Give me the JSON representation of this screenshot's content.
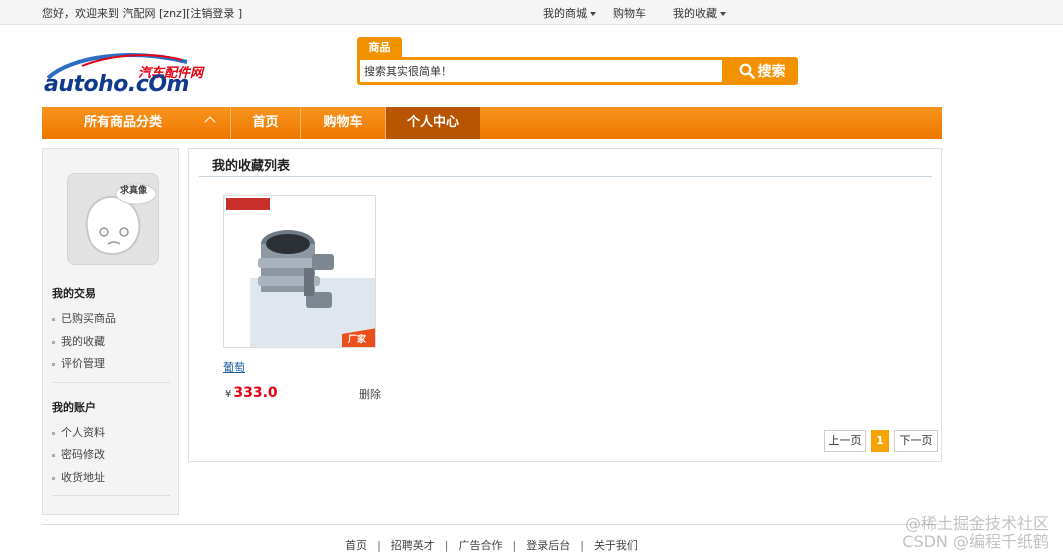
{
  "topbar": {
    "welcome_prefix": "您好，欢迎来到 汽配网",
    "username": "[znz][",
    "logout": "注销登录",
    "welcome_suffix": "]",
    "links": [
      {
        "label": "我的商城",
        "dropdown": true
      },
      {
        "label": "购物车",
        "dropdown": false
      },
      {
        "label": "我的收藏",
        "dropdown": true
      }
    ]
  },
  "logo": {
    "cn": "汽车配件网",
    "en": "autoho.cOm",
    "color_brand": "#123a8c",
    "color_accent": "#e60012"
  },
  "search": {
    "tab_label": "商品",
    "value": "搜索其实很简单！",
    "button_label": "搜索",
    "button_icon": "search-icon",
    "color": "#f39200"
  },
  "mainnav": {
    "category_label": "所有商品分类",
    "items": [
      {
        "label": "首页",
        "active": false
      },
      {
        "label": "购物车",
        "active": false
      },
      {
        "label": "个人中心",
        "active": true
      }
    ]
  },
  "sidebar": {
    "avatar_label": "求真像",
    "sections": [
      {
        "title": "我的交易",
        "links": [
          "已购买商品",
          "我的收藏",
          "评价管理"
        ]
      },
      {
        "title": "我的账户",
        "links": [
          "个人资料",
          "密码修改",
          "收货地址"
        ]
      }
    ]
  },
  "content": {
    "title": "我的收藏列表",
    "products": [
      {
        "name": "葡萄",
        "currency": "¥",
        "price": "333.0",
        "delete_label": "删除",
        "image_stamp": "厂家"
      }
    ],
    "pager": {
      "prev": "上一页",
      "current": "1",
      "next": "下一页"
    }
  },
  "footer": {
    "links": [
      "首页",
      "招聘英才",
      "广告合作",
      "登录后台",
      "关于我们"
    ]
  },
  "watermark": {
    "line1": "@稀土掘金技术社区",
    "line2": "CSDN @编程千纸鹤"
  }
}
